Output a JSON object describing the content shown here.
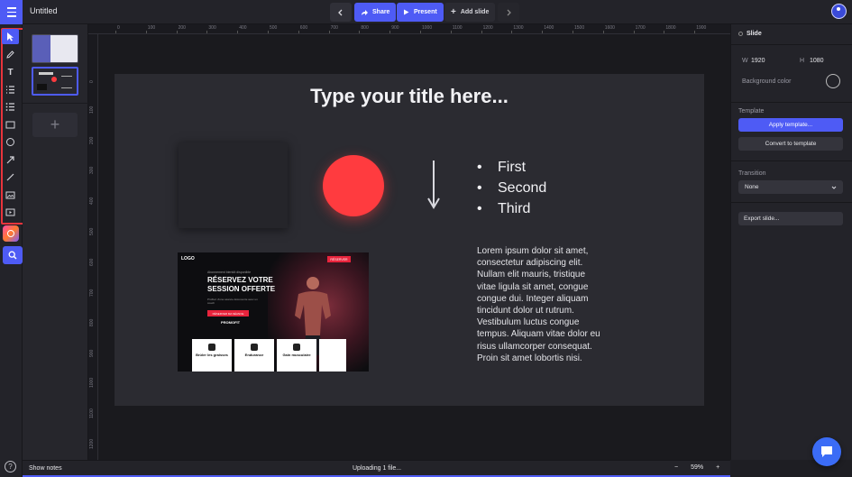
{
  "header": {
    "doc_title": "Untitled",
    "share_label": "Share",
    "present_label": "Present",
    "add_slide_label": "Add slide",
    "prev_icon": "chevron-left-icon",
    "next_icon": "chevron-right-icon"
  },
  "toolbar": {
    "tools": [
      "select-icon",
      "pen-icon",
      "text-icon",
      "numbered-list-icon",
      "bullet-list-icon",
      "rectangle-icon",
      "ellipse-icon",
      "arrow-icon",
      "line-icon",
      "image-icon",
      "video-icon"
    ],
    "text_tool_glyph": "T"
  },
  "slides_panel": {
    "selected_slide_number": "2",
    "add_icon": "+"
  },
  "ruler": {
    "top": [
      "0",
      "100",
      "200",
      "300",
      "400",
      "500",
      "600",
      "700",
      "800",
      "900",
      "1000",
      "1100",
      "1200",
      "1300",
      "1400",
      "1500",
      "1600",
      "1700",
      "1800",
      "1900"
    ],
    "left": [
      "0",
      "100",
      "200",
      "300",
      "400",
      "500",
      "600",
      "700",
      "800",
      "900",
      "1000",
      "1100",
      "1200"
    ]
  },
  "slide": {
    "title": "Type your title here...",
    "bullets": [
      "First",
      "Second",
      "Third"
    ],
    "body": "Lorem ipsum dolor sit amet, consectetur adipiscing elit. Nullam elit mauris, tristique vitae ligula sit amet, congue congue dui. Integer aliquam tincidunt dolor ut rutrum. Vestibulum luctus congue tempus. Aliquam vitae dolor eu risus ullamcorper consequat. Proin sit amet lobortis nisi.",
    "circle_color": "#ff3b3f",
    "image": {
      "logo": "LOGO",
      "tag": "RÉSERVER",
      "kicker": "Abonnement bientôt disponible",
      "headline_1": "RÉSERVEZ VOTRE",
      "headline_2": "SESSION OFFERTE",
      "sub": "Profitez d'une séance découverte avec un coach",
      "cta": "RÉSERVER MA SÉANCE",
      "partner": "PROMOFIT",
      "cards": [
        "Brûler les graisses",
        "Endurance",
        "Gain musculaire",
        ""
      ]
    }
  },
  "properties": {
    "heading": "Slide",
    "width_label": "W",
    "width_value": "1920",
    "height_label": "H",
    "height_value": "1080",
    "background_label": "Background color",
    "template_label": "Template",
    "apply_template": "Apply template...",
    "convert_template": "Convert to template",
    "transition_label": "Transition",
    "transition_value": "None",
    "export_label": "Export slide..."
  },
  "footer": {
    "show_notes": "Show notes",
    "upload_status": "Uploading 1 file...",
    "zoom_out": "−",
    "zoom_level": "59%",
    "zoom_in": "+"
  },
  "colors": {
    "accent": "#4e5bf5",
    "highlight_border": "#e8343c",
    "background": "#1e1e23"
  }
}
